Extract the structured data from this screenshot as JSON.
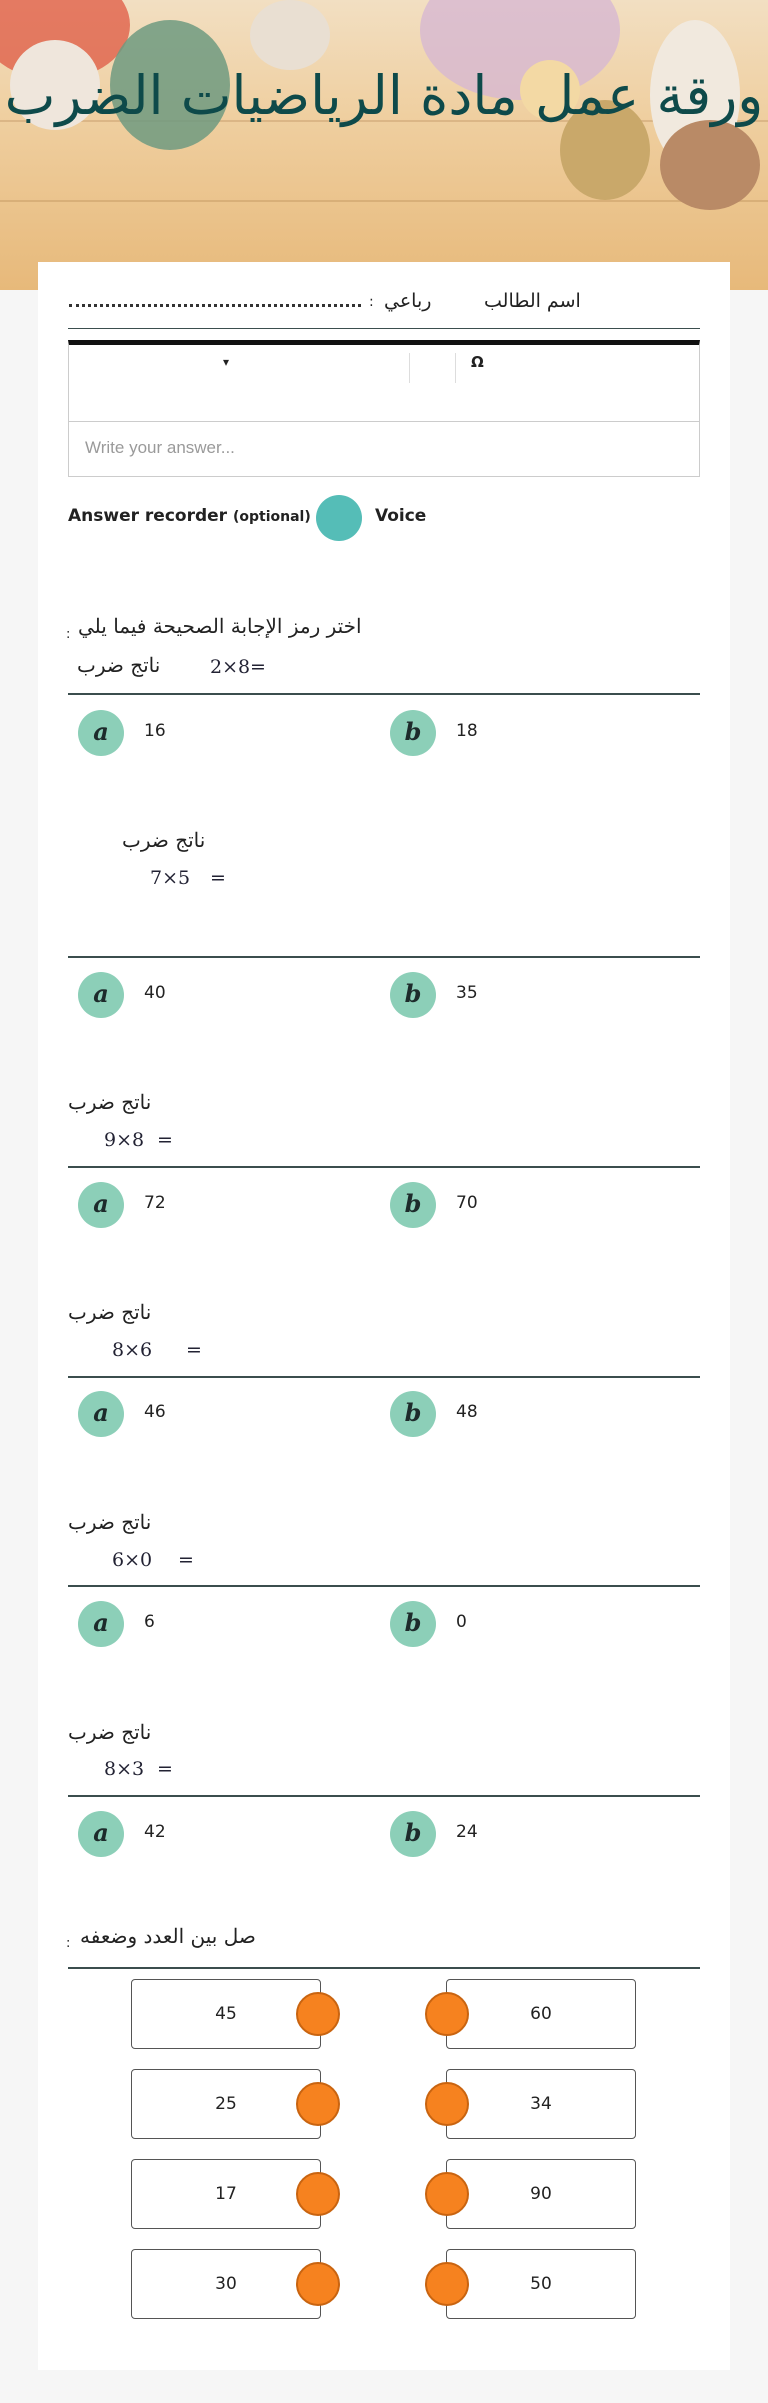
{
  "header": {
    "title": "ورقة عمل مادة الرياضيات الضرب"
  },
  "student": {
    "name_label": "اسم الطالب",
    "name_value": "رباعي",
    "sep": ":"
  },
  "toolbar": {
    "omega": "Ω",
    "dropdown_arrow": "▾"
  },
  "answer": {
    "placeholder": "Write your answer..."
  },
  "recorder": {
    "label": "Answer recorder",
    "optional": "(optional)",
    "dash": "-",
    "voice": "Voice"
  },
  "choose": {
    "instruction": "اختر رمز الإجابة الصحيحة فيما يلي",
    "sep": ":"
  },
  "questions": [
    {
      "text": "ناتج ضرب",
      "expr": "2×8",
      "eq": "=",
      "a_label": "a",
      "a": "16",
      "b_label": "b",
      "b": "18"
    },
    {
      "text": "ناتج ضرب",
      "expr": "7×5",
      "eq": "=",
      "a_label": "a",
      "a": "40",
      "b_label": "b",
      "b": "35"
    },
    {
      "text": "ناتج ضرب",
      "expr": "9×8",
      "eq": "=",
      "a_label": "a",
      "a": "72",
      "b_label": "b",
      "b": "70"
    },
    {
      "text": "ناتج ضرب",
      "expr": "8×6",
      "eq": "=",
      "a_label": "a",
      "a": "46",
      "b_label": "b",
      "b": "48"
    },
    {
      "text": "ناتج ضرب",
      "expr": "6×0",
      "eq": "=",
      "a_label": "a",
      "a": "6",
      "b_label": "b",
      "b": "0"
    },
    {
      "text": "ناتج ضرب",
      "expr": "8×3",
      "eq": "=",
      "a_label": "a",
      "a": "42",
      "b_label": "b",
      "b": "24"
    }
  ],
  "match": {
    "instruction": "صل بين العدد وضعفه",
    "sep": ":",
    "left": [
      "45",
      "25",
      "17",
      "30"
    ],
    "right": [
      "60",
      "34",
      "90",
      "50"
    ]
  },
  "colors": {
    "accent": "#55bdb7",
    "option": "#8ccfb8",
    "dot": "#f6821f",
    "title": "#0e4a4a"
  }
}
